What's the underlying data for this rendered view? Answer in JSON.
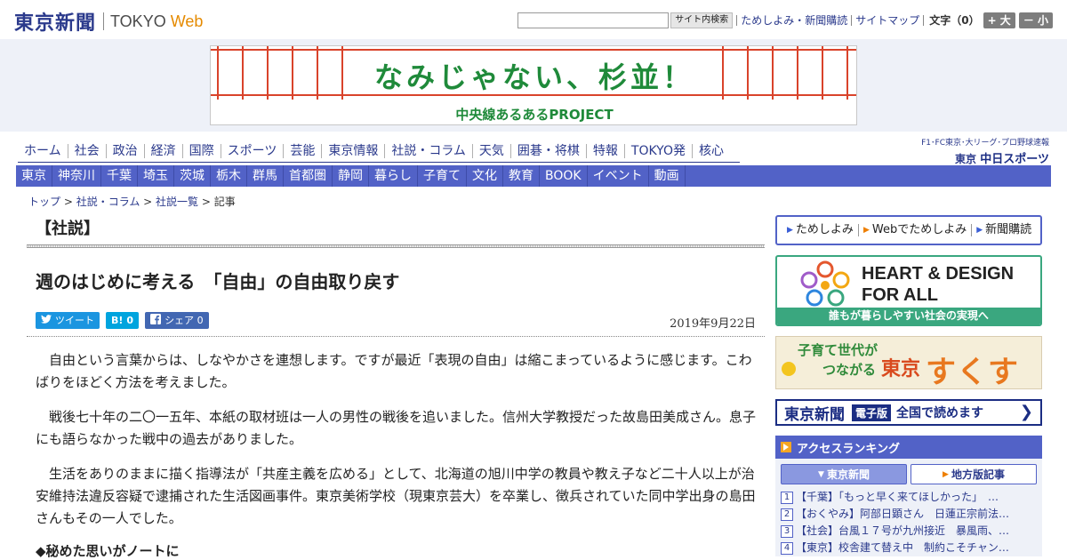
{
  "header": {
    "logo_jp": "東京新聞",
    "logo_tokyo": "TOKYO",
    "logo_web": "Web",
    "search_button": "サイト内検索",
    "links": [
      "ためしよみ・新聞購読",
      "サイトマップ"
    ],
    "fontsize_label": "文字（0）",
    "fontsize_up": "+ 大",
    "fontsize_down": "－ 小"
  },
  "banner": {
    "title": "なみじゃない、杉並！",
    "subtitle": "中央線あるあるPROJECT"
  },
  "nav_main": [
    "ホーム",
    "社会",
    "政治",
    "経済",
    "国際",
    "スポーツ",
    "芸能",
    "東京情報",
    "社説・コラム",
    "天気",
    "囲碁・将棋",
    "特報",
    "TOKYO発",
    "核心"
  ],
  "chunichi": {
    "top": "F1･FC東京･大リーグ･プロ野球速報",
    "prefix": "東京",
    "name": "中日スポーツ"
  },
  "nav_region": [
    "東京",
    "神奈川",
    "千葉",
    "埼玉",
    "茨城",
    "栃木",
    "群馬",
    "首都圏",
    "静岡",
    "暮らし",
    "子育て",
    "文化",
    "教育",
    "BOOK",
    "イベント",
    "動画"
  ],
  "breadcrumb": {
    "items": [
      "トップ",
      "社説・コラム",
      "社説一覧"
    ],
    "current": "記事",
    "sep": " > "
  },
  "article": {
    "section": "【社説】",
    "title": "週のはじめに考える　「自由」の自由取り戻す",
    "tweet": "ツイート",
    "hatena_icon": "B!",
    "hatena_count": "0",
    "fb_label": "シェア",
    "fb_count": "0",
    "date": "2019年9月22日",
    "paragraphs": [
      "自由という言葉からは、しなやかさを連想します。ですが最近「表現の自由」は縮こまっているように感じます。こわばりをほどく方法を考えました。",
      "戦後七十年の二〇一五年、本紙の取材班は一人の男性の戦後を追いました。信州大学教授だった故島田美成さん。息子にも語らなかった戦中の過去がありました。",
      "生活をありのままに描く指導法が「共産主義を広める」として、北海道の旭川中学の教員や教え子など二十人以上が治安維持法違反容疑で逮捕された生活図画事件。東京美術学校（現東京芸大）を卒業し、徴兵されていた同中学出身の島田さんもその一人でした。"
    ],
    "subheading": "◆秘めた思いがノートに"
  },
  "sidebar": {
    "promo_links": [
      "ためしよみ",
      "Webでためしよみ",
      "新聞購読"
    ],
    "heart_title_1": "HEART & DESIGN",
    "heart_title_2": "FOR ALL",
    "heart_sub": "誰もが暮らしやすい社会の実現へ",
    "suku_line1": "子育て世代が",
    "suku_line2": "つながる",
    "suku_tokyo": "東京",
    "suku_main": "すくすく",
    "epaper_logo": "東京新聞",
    "epaper_badge": "電子版",
    "epaper_text": "全国で読めます",
    "epaper_arrow": "❯",
    "ranking_title": "アクセスランキング",
    "ranking_tab_tokyo": "東京新聞",
    "ranking_tab_local": "地方版記事",
    "ranking": [
      "【千葉】「もっと早く来てほしかった」　…",
      "【おくやみ】阿部日顕さん　日蓮正宗前法…",
      "【社会】台風１７号が九州接近　暴風雨、…",
      "【東京】校舎建て替え中　制約こそチャン…"
    ]
  },
  "colors": {
    "brand_navy": "#2b3a8c",
    "nav_blue": "#5262c7",
    "banner_green": "#1f8a3a",
    "heart_green": "#3aa77f",
    "web_orange": "#e58a00"
  }
}
